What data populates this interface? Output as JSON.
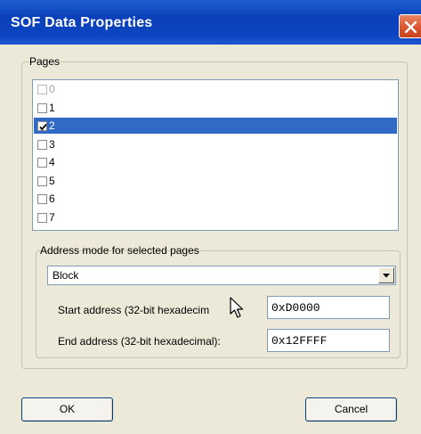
{
  "window": {
    "title": "SOF Data Properties",
    "close_icon": "close-icon"
  },
  "pages_group": {
    "label": "Pages",
    "items": [
      {
        "label": "0",
        "checked": false,
        "selected": false,
        "disabled": true
      },
      {
        "label": "1",
        "checked": false,
        "selected": false,
        "disabled": false
      },
      {
        "label": "2",
        "checked": true,
        "selected": true,
        "disabled": false
      },
      {
        "label": "3",
        "checked": false,
        "selected": false,
        "disabled": false
      },
      {
        "label": "4",
        "checked": false,
        "selected": false,
        "disabled": false
      },
      {
        "label": "5",
        "checked": false,
        "selected": false,
        "disabled": false
      },
      {
        "label": "6",
        "checked": false,
        "selected": false,
        "disabled": false
      },
      {
        "label": "7",
        "checked": false,
        "selected": false,
        "disabled": false
      }
    ]
  },
  "address_group": {
    "label": "Address mode for selected pages",
    "mode_value": "Block",
    "start_label": "Start address (32-bit hexadecim",
    "start_value": "0xD0000",
    "end_label": "End address (32-bit hexadecimal):",
    "end_value": "0x12FFFF"
  },
  "buttons": {
    "ok": "OK",
    "cancel": "Cancel"
  },
  "colors": {
    "title_bar": "#0a3fb8",
    "selection": "#316ac5",
    "dialog_bg": "#ece9d8",
    "close_button": "#d9532b"
  }
}
